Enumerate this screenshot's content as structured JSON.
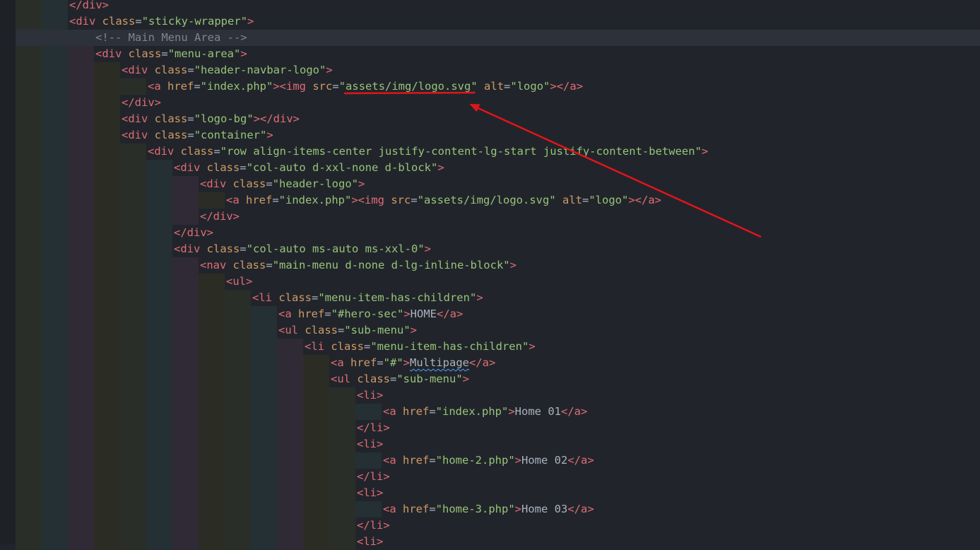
{
  "editor": {
    "lines": [
      {
        "indent": 2,
        "tokens": [
          {
            "t": "tag",
            "v": "</div>"
          }
        ]
      },
      {
        "indent": 2,
        "tokens": [
          {
            "t": "tag",
            "v": "<div "
          },
          {
            "t": "attr",
            "v": "class"
          },
          {
            "t": "txt",
            "v": "="
          },
          {
            "t": "str",
            "v": "\"sticky-wrapper\""
          },
          {
            "t": "tag",
            "v": ">"
          }
        ]
      },
      {
        "indent": 3,
        "current": true,
        "tokens": [
          {
            "t": "cmt",
            "v": "<!-- Main Menu Area -->"
          }
        ]
      },
      {
        "indent": 3,
        "tokens": [
          {
            "t": "tag",
            "v": "<div "
          },
          {
            "t": "attr",
            "v": "class"
          },
          {
            "t": "txt",
            "v": "="
          },
          {
            "t": "str",
            "v": "\"menu-area\""
          },
          {
            "t": "tag",
            "v": ">"
          }
        ]
      },
      {
        "indent": 4,
        "tokens": [
          {
            "t": "tag",
            "v": "<div "
          },
          {
            "t": "attr",
            "v": "class"
          },
          {
            "t": "txt",
            "v": "="
          },
          {
            "t": "str",
            "v": "\"header-navbar-logo\""
          },
          {
            "t": "tag",
            "v": ">"
          }
        ]
      },
      {
        "indent": 5,
        "tokens": [
          {
            "t": "tag",
            "v": "<a "
          },
          {
            "t": "attr",
            "v": "href"
          },
          {
            "t": "txt",
            "v": "="
          },
          {
            "t": "str",
            "v": "\"index.php\""
          },
          {
            "t": "tag",
            "v": ">"
          },
          {
            "t": "tag",
            "v": "<img "
          },
          {
            "t": "attr",
            "v": "src"
          },
          {
            "t": "txt",
            "v": "="
          },
          {
            "t": "str",
            "v": "\""
          },
          {
            "t": "str",
            "v": "assets/img/logo.svg",
            "mark": "highlight"
          },
          {
            "t": "str",
            "v": "\""
          },
          {
            "t": "txt",
            "v": " "
          },
          {
            "t": "attr",
            "v": "alt"
          },
          {
            "t": "txt",
            "v": "="
          },
          {
            "t": "str",
            "v": "\"logo\""
          },
          {
            "t": "tag",
            "v": "></a>"
          }
        ]
      },
      {
        "indent": 4,
        "tokens": [
          {
            "t": "tag",
            "v": "</div>"
          }
        ]
      },
      {
        "indent": 4,
        "tokens": [
          {
            "t": "tag",
            "v": "<div "
          },
          {
            "t": "attr",
            "v": "class"
          },
          {
            "t": "txt",
            "v": "="
          },
          {
            "t": "str",
            "v": "\"logo-bg\""
          },
          {
            "t": "tag",
            "v": "></div>"
          }
        ]
      },
      {
        "indent": 4,
        "tokens": [
          {
            "t": "tag",
            "v": "<div "
          },
          {
            "t": "attr",
            "v": "class"
          },
          {
            "t": "txt",
            "v": "="
          },
          {
            "t": "str",
            "v": "\"container\""
          },
          {
            "t": "tag",
            "v": ">"
          }
        ]
      },
      {
        "indent": 5,
        "tokens": [
          {
            "t": "tag",
            "v": "<div "
          },
          {
            "t": "attr",
            "v": "class"
          },
          {
            "t": "txt",
            "v": "="
          },
          {
            "t": "str",
            "v": "\"row align-items-center justify-content-lg-start justify-content-between\""
          },
          {
            "t": "tag",
            "v": ">"
          }
        ]
      },
      {
        "indent": 6,
        "tokens": [
          {
            "t": "tag",
            "v": "<div "
          },
          {
            "t": "attr",
            "v": "class"
          },
          {
            "t": "txt",
            "v": "="
          },
          {
            "t": "str",
            "v": "\"col-auto d-xxl-none d-block\""
          },
          {
            "t": "tag",
            "v": ">"
          }
        ]
      },
      {
        "indent": 7,
        "tokens": [
          {
            "t": "tag",
            "v": "<div "
          },
          {
            "t": "attr",
            "v": "class"
          },
          {
            "t": "txt",
            "v": "="
          },
          {
            "t": "str",
            "v": "\"header-logo\""
          },
          {
            "t": "tag",
            "v": ">"
          }
        ]
      },
      {
        "indent": 8,
        "tokens": [
          {
            "t": "tag",
            "v": "<a "
          },
          {
            "t": "attr",
            "v": "href"
          },
          {
            "t": "txt",
            "v": "="
          },
          {
            "t": "str",
            "v": "\"index.php\""
          },
          {
            "t": "tag",
            "v": ">"
          },
          {
            "t": "tag",
            "v": "<img "
          },
          {
            "t": "attr",
            "v": "src"
          },
          {
            "t": "txt",
            "v": "="
          },
          {
            "t": "str",
            "v": "\"assets/img/logo.svg\""
          },
          {
            "t": "txt",
            "v": " "
          },
          {
            "t": "attr",
            "v": "alt"
          },
          {
            "t": "txt",
            "v": "="
          },
          {
            "t": "str",
            "v": "\"logo\""
          },
          {
            "t": "tag",
            "v": "></a>"
          }
        ]
      },
      {
        "indent": 7,
        "tokens": [
          {
            "t": "tag",
            "v": "</div>"
          }
        ]
      },
      {
        "indent": 6,
        "tokens": [
          {
            "t": "tag",
            "v": "</div>"
          }
        ]
      },
      {
        "indent": 6,
        "tokens": [
          {
            "t": "tag",
            "v": "<div "
          },
          {
            "t": "attr",
            "v": "class"
          },
          {
            "t": "txt",
            "v": "="
          },
          {
            "t": "str",
            "v": "\"col-auto ms-auto ms-xxl-0\""
          },
          {
            "t": "tag",
            "v": ">"
          }
        ]
      },
      {
        "indent": 7,
        "tokens": [
          {
            "t": "tag",
            "v": "<nav "
          },
          {
            "t": "attr",
            "v": "class"
          },
          {
            "t": "txt",
            "v": "="
          },
          {
            "t": "str",
            "v": "\"main-menu d-none d-lg-inline-block\""
          },
          {
            "t": "tag",
            "v": ">"
          }
        ]
      },
      {
        "indent": 8,
        "tokens": [
          {
            "t": "tag",
            "v": "<ul"
          },
          {
            "t": "tag",
            "v": ">"
          }
        ]
      },
      {
        "indent": 9,
        "tokens": [
          {
            "t": "tag",
            "v": "<li "
          },
          {
            "t": "attr",
            "v": "class"
          },
          {
            "t": "txt",
            "v": "="
          },
          {
            "t": "str",
            "v": "\"menu-item-has-children\""
          },
          {
            "t": "tag",
            "v": ">"
          }
        ]
      },
      {
        "indent": 10,
        "tokens": [
          {
            "t": "tag",
            "v": "<a "
          },
          {
            "t": "attr",
            "v": "href"
          },
          {
            "t": "txt",
            "v": "="
          },
          {
            "t": "str",
            "v": "\"#hero-sec\""
          },
          {
            "t": "tag",
            "v": ">"
          },
          {
            "t": "txt",
            "v": "HOME"
          },
          {
            "t": "tag",
            "v": "</a>"
          }
        ]
      },
      {
        "indent": 10,
        "tokens": [
          {
            "t": "tag",
            "v": "<ul "
          },
          {
            "t": "attr",
            "v": "class"
          },
          {
            "t": "txt",
            "v": "="
          },
          {
            "t": "str",
            "v": "\"sub-menu\""
          },
          {
            "t": "tag",
            "v": ">"
          }
        ]
      },
      {
        "indent": 11,
        "tokens": [
          {
            "t": "tag",
            "v": "<li "
          },
          {
            "t": "attr",
            "v": "class"
          },
          {
            "t": "txt",
            "v": "="
          },
          {
            "t": "str",
            "v": "\"menu-item-has-children\""
          },
          {
            "t": "tag",
            "v": ">"
          }
        ]
      },
      {
        "indent": 12,
        "tokens": [
          {
            "t": "tag",
            "v": "<a "
          },
          {
            "t": "attr",
            "v": "href"
          },
          {
            "t": "txt",
            "v": "="
          },
          {
            "t": "str",
            "v": "\"#\""
          },
          {
            "t": "tag",
            "v": ">"
          },
          {
            "t": "txt",
            "v": "Multipage",
            "mark": "squiggle"
          },
          {
            "t": "tag",
            "v": "</a>"
          }
        ]
      },
      {
        "indent": 12,
        "tokens": [
          {
            "t": "tag",
            "v": "<ul "
          },
          {
            "t": "attr",
            "v": "class"
          },
          {
            "t": "txt",
            "v": "="
          },
          {
            "t": "str",
            "v": "\"sub-menu\""
          },
          {
            "t": "tag",
            "v": ">"
          }
        ]
      },
      {
        "indent": 13,
        "tokens": [
          {
            "t": "tag",
            "v": "<li"
          },
          {
            "t": "tag",
            "v": ">"
          }
        ]
      },
      {
        "indent": 14,
        "tokens": [
          {
            "t": "tag",
            "v": "<a "
          },
          {
            "t": "attr",
            "v": "href"
          },
          {
            "t": "txt",
            "v": "="
          },
          {
            "t": "str",
            "v": "\"index.php\""
          },
          {
            "t": "tag",
            "v": ">"
          },
          {
            "t": "txt",
            "v": "Home 01"
          },
          {
            "t": "tag",
            "v": "</a>"
          }
        ]
      },
      {
        "indent": 13,
        "tokens": [
          {
            "t": "tag",
            "v": "</li>"
          }
        ]
      },
      {
        "indent": 13,
        "tokens": [
          {
            "t": "tag",
            "v": "<li"
          },
          {
            "t": "tag",
            "v": ">"
          }
        ]
      },
      {
        "indent": 14,
        "tokens": [
          {
            "t": "tag",
            "v": "<a "
          },
          {
            "t": "attr",
            "v": "href"
          },
          {
            "t": "txt",
            "v": "="
          },
          {
            "t": "str",
            "v": "\"home-2.php\""
          },
          {
            "t": "tag",
            "v": ">"
          },
          {
            "t": "txt",
            "v": "Home 02"
          },
          {
            "t": "tag",
            "v": "</a>"
          }
        ]
      },
      {
        "indent": 13,
        "tokens": [
          {
            "t": "tag",
            "v": "</li>"
          }
        ]
      },
      {
        "indent": 13,
        "tokens": [
          {
            "t": "tag",
            "v": "<li"
          },
          {
            "t": "tag",
            "v": ">"
          }
        ]
      },
      {
        "indent": 14,
        "tokens": [
          {
            "t": "tag",
            "v": "<a "
          },
          {
            "t": "attr",
            "v": "href"
          },
          {
            "t": "txt",
            "v": "="
          },
          {
            "t": "str",
            "v": "\"home-3.php\""
          },
          {
            "t": "tag",
            "v": ">"
          },
          {
            "t": "txt",
            "v": "Home 03"
          },
          {
            "t": "tag",
            "v": "</a>"
          }
        ]
      },
      {
        "indent": 13,
        "tokens": [
          {
            "t": "tag",
            "v": "</li>"
          }
        ]
      },
      {
        "indent": 13,
        "tokens": [
          {
            "t": "tag",
            "v": "<li"
          },
          {
            "t": "tag",
            "v": ">"
          }
        ]
      }
    ]
  },
  "theme": {
    "indent_guide_colors": [
      "#2a2e29",
      "#243033",
      "#2f2a36",
      "#2b2d25"
    ],
    "annotation_color": "#e0151a"
  }
}
